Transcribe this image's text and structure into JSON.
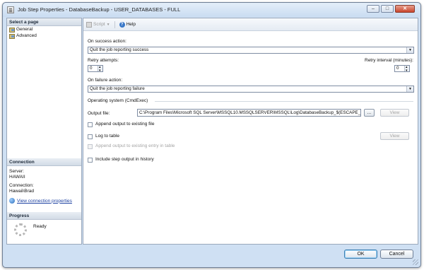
{
  "window": {
    "title": "Job Step Properties - DatabaseBackup - USER_DATABASES - FULL"
  },
  "left": {
    "select_header": "Select a page",
    "pages": [
      {
        "label": "General",
        "icon": "page-icon"
      },
      {
        "label": "Advanced",
        "icon": "page-icon"
      }
    ],
    "connection_header": "Connection",
    "server_label": "Server:",
    "server_value": "HAWAII",
    "connection_label": "Connection:",
    "connection_value": "Hawaii\\Brad",
    "view_connection_link": "View connection properties",
    "progress_header": "Progress",
    "progress_status": "Ready"
  },
  "toolbar": {
    "script_label": "Script",
    "help_label": "Help"
  },
  "form": {
    "on_success_label": "On success action:",
    "on_success_value": "Quit the job reporting success",
    "retry_attempts_label": "Retry attempts:",
    "retry_attempts_value": "0",
    "retry_interval_label": "Retry interval (minutes):",
    "retry_interval_value": "0",
    "on_failure_label": "On failure action:",
    "on_failure_value": "Quit the job reporting failure",
    "os_group_label": "Operating system (CmdExec)",
    "output_file_label": "Output file:",
    "output_file_value": "C:\\Program Files\\Microsoft SQL Server\\MSSQL10.MSSQLSERVER\\MSSQL\\Log\\DatabaseBackup_$(ESCAPE_",
    "browse_label": "...",
    "view_label": "View",
    "append_output_label": "Append output to existing file",
    "log_to_table_label": "Log to table",
    "view_table_label": "View",
    "append_table_label": "Append output to existing entry in table",
    "include_history_label": "Include step output in history"
  },
  "footer": {
    "ok_label": "OK",
    "cancel_label": "Cancel"
  },
  "colors": {
    "window_frame": "#cfe0f3",
    "link": "#1a3fa0",
    "accent": "#3c7fb1"
  }
}
